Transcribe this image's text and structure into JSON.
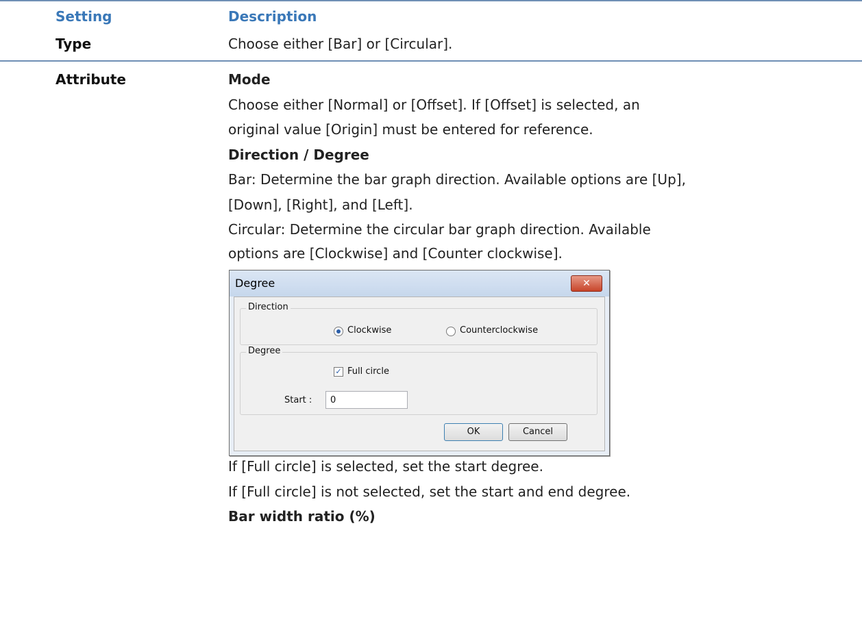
{
  "table": {
    "headers": {
      "setting": "Setting",
      "description": "Description"
    },
    "rows": [
      {
        "setting": "Type",
        "description": "Choose either [Bar] or [Circular]."
      },
      {
        "setting": "Attribute"
      }
    ]
  },
  "attribute": {
    "mode_heading": "Mode",
    "mode_line1": "Choose either [Normal] or [Offset]. If [Offset] is selected, an",
    "mode_line2": "original value [Origin] must be entered for reference.",
    "direction_heading": "Direction / Degree",
    "bar_line1": "Bar: Determine the bar graph direction. Available options are [Up],",
    "bar_line2": "[Down], [Right], and [Left].",
    "circular_line1": "Circular: Determine the circular bar graph direction. Available",
    "circular_line2": "options are [Clockwise] and [Counter clockwise].",
    "full_selected": "If [Full circle] is selected, set the start degree.",
    "full_not_selected": "If [Full circle] is not selected, set the start and end degree.",
    "bar_width_heading": "Bar width ratio (%)"
  },
  "dialog": {
    "title": "Degree",
    "close_symbol": "✕",
    "direction_group": "Direction",
    "clockwise": "Clockwise",
    "counterclockwise": "Counterclockwise",
    "degree_group": "Degree",
    "full_circle": "Full circle",
    "full_circle_checked": true,
    "start_label": "Start :",
    "start_value": "0",
    "ok": "OK",
    "cancel": "Cancel"
  },
  "colors": {
    "header_text": "#3a78b8",
    "rule": "#6f8fb5"
  }
}
